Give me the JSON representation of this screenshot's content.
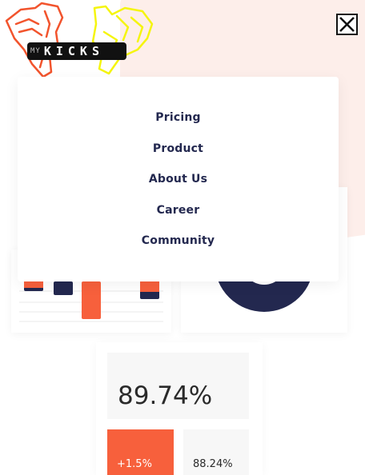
{
  "logo": {
    "text_prefix": "MY",
    "text_main": "KICKS"
  },
  "close_button": {
    "icon": "close-icon"
  },
  "menu": {
    "items": [
      {
        "label": "Pricing"
      },
      {
        "label": "Product"
      },
      {
        "label": "About Us"
      },
      {
        "label": "Career"
      },
      {
        "label": "Community"
      }
    ]
  },
  "stats": {
    "main_value": "89.74%",
    "change_value": "+1.5%",
    "secondary_value": "88.24%"
  },
  "colors": {
    "accent": "#f7603c",
    "navy": "#23284f",
    "logo_yellow": "#f5f50e",
    "logo_orange": "#f2542d",
    "background_tint": "#fdeeea"
  }
}
